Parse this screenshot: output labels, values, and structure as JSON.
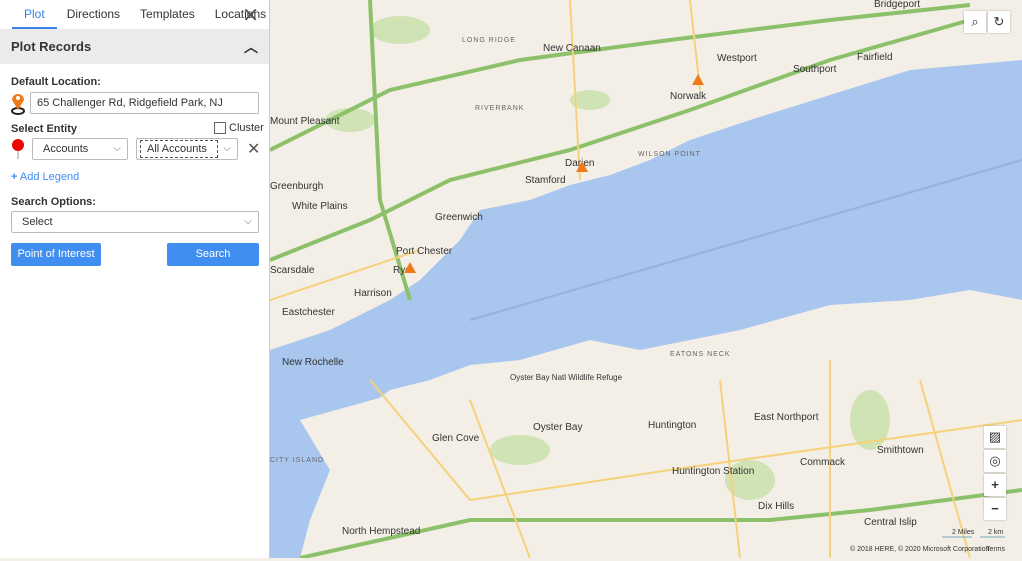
{
  "tabs": [
    "Plot",
    "Directions",
    "Templates",
    "Locations"
  ],
  "section_title": "Plot Records",
  "default_location": {
    "label": "Default Location:",
    "value": "65 Challenger Rd, Ridgefield Park, NJ"
  },
  "select_entity": {
    "label": "Select Entity",
    "cluster_label": "Cluster",
    "cluster_checked": false,
    "entity": "Accounts",
    "view": "All Accounts"
  },
  "add_legend": "Add Legend",
  "search_options": {
    "label": "Search Options:",
    "value": "Select"
  },
  "buttons": {
    "poi": "Point of Interest",
    "search": "Search"
  },
  "map": {
    "places": [
      "Bridgeport",
      "New Canaan",
      "Westport",
      "Fairfield",
      "Southport",
      "Norwalk",
      "Mount Pleasant",
      "Darien",
      "Stamford",
      "Greenwich",
      "White Plains",
      "Greenburgh",
      "Port Chester",
      "Rye",
      "Harrison",
      "Scarsdale",
      "Eastchester",
      "New Rochelle",
      "Oyster Bay",
      "Glen Cove",
      "Huntington",
      "East Northport",
      "Smithtown",
      "Commack",
      "Huntington Station",
      "Dix Hills",
      "Central Islip",
      "North Hempstead",
      "Oyster Bay Natl Wildlife Refuge"
    ],
    "areas": [
      "LONG RIDGE",
      "RIVERBANK",
      "WILSON POINT",
      "EATONS NECK",
      "CITY ISLAND"
    ],
    "scale": [
      "2 Miles",
      "2 km"
    ],
    "copyright": "© 2018 HERE, © 2020 Microsoft Corporation",
    "terms": "Terms",
    "colors": {
      "land": "#f3efe7",
      "water": "#a9c6ef",
      "park": "#cfe3b4",
      "highway": "#8dc06a",
      "road": "#f5d27a",
      "accent": "#3f8ef0"
    }
  }
}
